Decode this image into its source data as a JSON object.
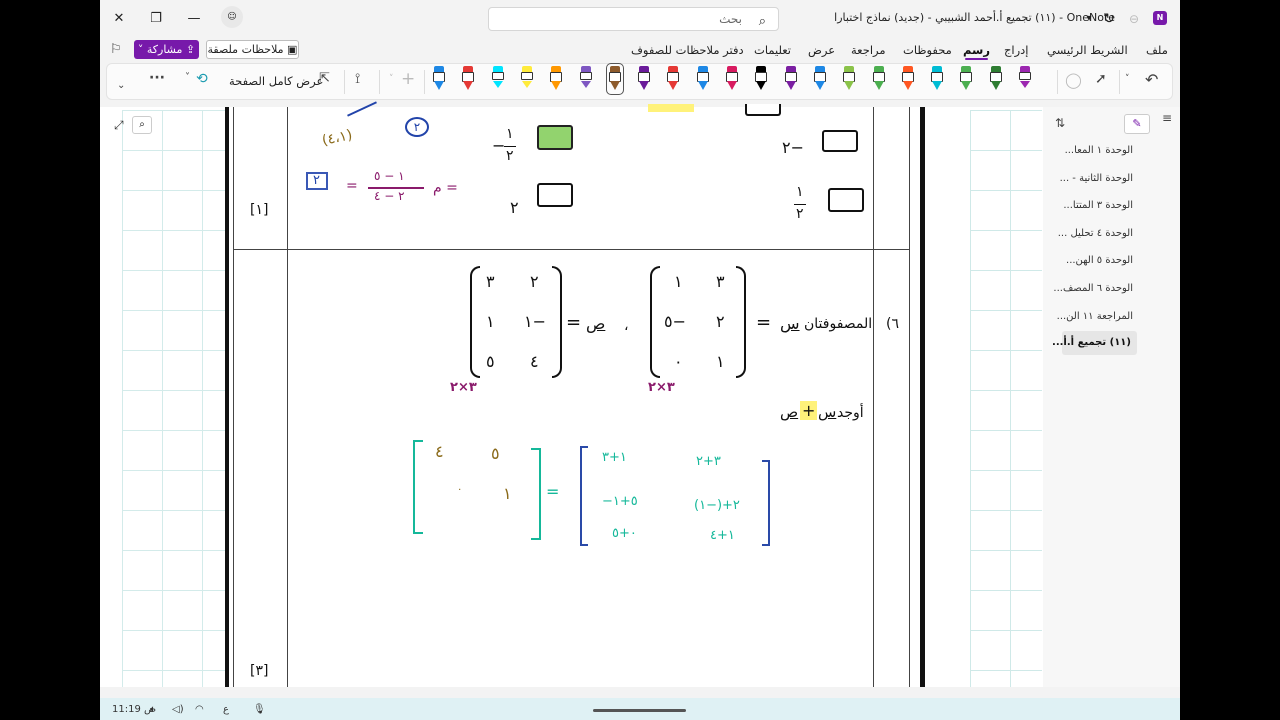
{
  "window": {
    "app_name": "OneNote",
    "title": "(١١) تجميع أ.أحمد الشبيبي - (جديد) نماذج اختبارا",
    "search_placeholder": "بحث"
  },
  "menu": {
    "items": [
      "ملف",
      "الشريط الرئيسي",
      "إدراج",
      "رسم",
      "محفوظات",
      "مراجعة",
      "عرض",
      "تعليمات",
      "دفتر ملاحظات للصفوف"
    ],
    "active": "رسم",
    "share_label": "مشاركة",
    "sticky_notes_label": "ملاحظات ملصقة"
  },
  "ribbon": {
    "fullpage_label": "عرض كامل الصفحة",
    "more_label": "···",
    "pen_colors": [
      "#9c27b0",
      "#2e7d32",
      "#4caf50",
      "#00bcd4",
      "#ff5722",
      "#4caf50",
      "#8bc34a",
      "#1e88e5",
      "#7b1fa2",
      "#000000",
      "#d81b60",
      "#1e88e5",
      "#e53935",
      "#6a1b9a",
      "#8d5a2b",
      "#7e57c2",
      "#ff9800",
      "#ffeb3b",
      "#00e5ff",
      "#e53935",
      "#1e88e5"
    ]
  },
  "sidebar": {
    "pages": [
      "الوحدة ١ المعا...",
      "الوحدة الثانية - ...",
      "الوحدة ٣ المتتا...",
      "الوحدة ٤ تحليل ...",
      "الوحدة ٥ الهن...",
      "الوحدة ٦ المصف...",
      "المراجعة ١١ الن...",
      "(١١) تجميع أ.أ..."
    ],
    "selected_index": 7
  },
  "question_prev": {
    "options": [
      "−٢",
      "−١/٢",
      "١/٢",
      "٢"
    ],
    "mark": "[١]",
    "ink_work": "م = (٥ − ١)/(٤ − ٢) = ٢",
    "ink_point": "(٤،١)",
    "ink_circle": "٢"
  },
  "question6": {
    "number": "٦)",
    "text": "المصفوفتان",
    "matrix_s_label": "س",
    "matrix_s": [
      [
        "٣",
        "١"
      ],
      [
        "٢",
        "−٥"
      ],
      [
        "١",
        "٠"
      ]
    ],
    "matrix_p_label": "ص",
    "matrix_p": [
      [
        "٢",
        "٣"
      ],
      [
        "−١",
        "١"
      ],
      [
        "٤",
        "٥"
      ]
    ],
    "comma": "،",
    "ink_dims_1": "٣×٢",
    "ink_dims_2": "٣×٢",
    "find_text": "أوجد",
    "find_expr_s": "س",
    "find_plus": "+",
    "find_expr_p": "ص",
    "ink_sum_expanded": [
      [
        "٣+٢",
        "١+٣"
      ],
      [
        "٢+(−١)",
        "−٥+١"
      ],
      [
        "١+٤",
        "٠+٥"
      ]
    ],
    "ink_result": [
      [
        "٥",
        "٤"
      ],
      [
        "١",
        "٠"
      ]
    ],
    "mark": "[٣]"
  },
  "taskbar": {
    "time": "11:19 ص",
    "lang": "ع"
  }
}
